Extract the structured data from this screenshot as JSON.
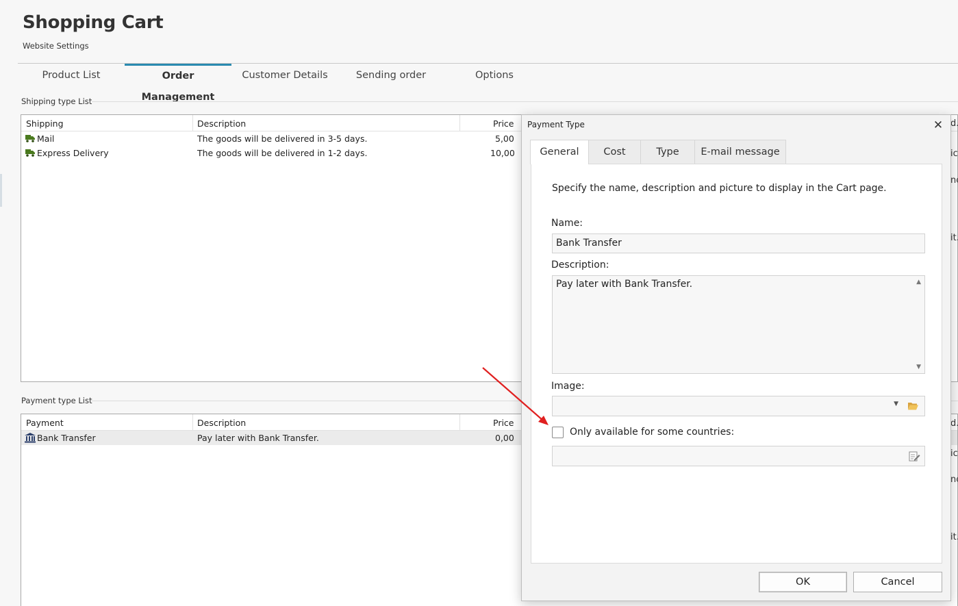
{
  "header": {
    "title": "Shopping Cart",
    "subtitle": "Website Settings"
  },
  "main_tabs": [
    {
      "label": "Product List",
      "active": false
    },
    {
      "label": "Order Management",
      "active": true
    },
    {
      "label": "Customer Details",
      "active": false
    },
    {
      "label": "Sending order",
      "active": false
    },
    {
      "label": "Options",
      "active": false
    }
  ],
  "shipping": {
    "group_label": "Shipping type List",
    "columns": [
      "Shipping",
      "Description",
      "Price"
    ],
    "rows": [
      {
        "name": "Mail",
        "description": "The goods will be delivered in 3-5 days.",
        "price": "5,00",
        "icon": "truck-icon"
      },
      {
        "name": "Express Delivery",
        "description": "The goods will be delivered in 1-2 days.",
        "price": "10,00",
        "icon": "truck-icon"
      }
    ]
  },
  "payment": {
    "group_label": "Payment type List",
    "columns": [
      "Payment",
      "Description",
      "Price"
    ],
    "rows": [
      {
        "name": "Bank Transfer",
        "description": "Pay later with Bank Transfer.",
        "price": "0,00",
        "icon": "bank-icon",
        "selected": true
      }
    ]
  },
  "right_fragments": [
    "d.",
    "ic",
    "no",
    "it.",
    "d.",
    "ic",
    "no",
    "it."
  ],
  "dialog": {
    "title": "Payment Type",
    "tabs": [
      {
        "label": "General",
        "active": true
      },
      {
        "label": "Cost",
        "active": false
      },
      {
        "label": "Type",
        "active": false
      },
      {
        "label": "E-mail message",
        "active": false
      }
    ],
    "hint": "Specify the name, description and picture to display in the Cart page.",
    "name_label": "Name:",
    "name_value": "Bank Transfer",
    "description_label": "Description:",
    "description_value": "Pay later with Bank Transfer.",
    "image_label": "Image:",
    "image_value": "",
    "countries_checkbox_label": "Only available for some countries:",
    "countries_checked": false,
    "countries_value": "",
    "ok_label": "OK",
    "cancel_label": "Cancel"
  },
  "colors": {
    "tab_accent": "#2a8ab0",
    "annotation_arrow": "#e02020",
    "truck_icon": "#4a7a1e",
    "bank_icon": "#2b3f6b"
  }
}
